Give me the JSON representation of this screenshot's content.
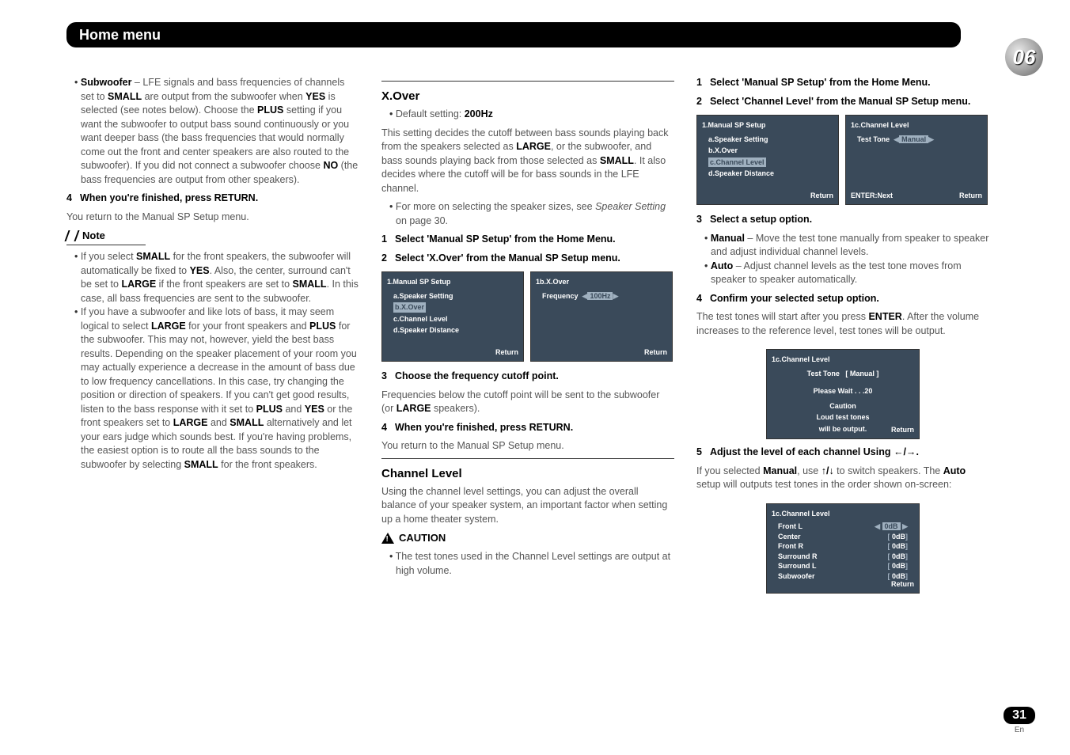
{
  "header": {
    "title": "Home menu"
  },
  "chapter": "06",
  "col1": {
    "sub_item": "Subwoofer",
    "sub_text_a": " – LFE signals and bass frequencies of channels set to ",
    "sub_small": "SMALL",
    "sub_text_b": " are output from the subwoofer when ",
    "sub_yes": "YES",
    "sub_text_c": " is selected (see notes below). Choose the ",
    "sub_plus": "PLUS",
    "sub_text_d": " setting if you want the subwoofer to output bass sound continuously or you want deeper bass (the bass frequencies that would normally come out the front and center speakers are also routed to the subwoofer). If you did not connect a subwoofer choose ",
    "sub_no": "NO",
    "sub_text_e": " (the bass frequencies are output from other speakers).",
    "step4": "When you're finished, press RETURN.",
    "step4_after": "You return to the Manual SP Setup menu.",
    "note_label": "Note",
    "note1_a": "If you select ",
    "note1_small": "SMALL",
    "note1_b": " for the front speakers, the subwoofer will automatically be fixed to ",
    "note1_yes": "YES",
    "note1_c": ". Also, the center, surround can't be set to ",
    "note1_large": "LARGE",
    "note1_d": " if the front speakers are set to ",
    "note1_small2": "SMALL",
    "note1_e": ". In this case, all bass frequencies are sent to the subwoofer.",
    "note2_a": "If you have a subwoofer and like lots of bass, it may seem logical to select ",
    "note2_large": "LARGE",
    "note2_b": " for your front speakers and ",
    "note2_plus": "PLUS",
    "note2_c": " for the subwoofer. This may not, however, yield the best bass results. Depending on the speaker placement of your room you may actually experience a decrease in the amount of bass due to low frequency cancellations. In this case, try changing the position or direction of speakers. If you can't get good results, listen to the bass response with it set to ",
    "note2_plus2": "PLUS",
    "note2_d": " and ",
    "note2_yes": "YES",
    "note2_e": " or the front speakers set to ",
    "note2_large2": "LARGE",
    "note2_f": " and ",
    "note2_small": "SMALL",
    "note2_g": " alternatively and let your ears judge which sounds best. If you're having problems, the easiest option is to route all the bass sounds to the subwoofer by selecting ",
    "note2_small2": "SMALL",
    "note2_h": " for the front speakers."
  },
  "col2": {
    "xover_title": "X.Over",
    "default_label": "Default setting: ",
    "default_val": "200Hz",
    "xover_desc_a": "This setting decides the cutoff between bass sounds playing back from the speakers selected as ",
    "xover_large": "LARGE",
    "xover_desc_b": ", or the subwoofer, and bass sounds playing back from those selected as ",
    "xover_small": "SMALL",
    "xover_desc_c": ". It also decides where the cutoff will be for bass sounds in the LFE channel.",
    "xover_more_a": "For more on selecting the speaker sizes, see ",
    "xover_more_i": "Speaker Setting",
    "xover_more_b": " on page 30.",
    "step1": "Select 'Manual SP Setup' from the Home Menu.",
    "step2": "Select 'X.Over' from the Manual SP Setup menu.",
    "osd1": {
      "title": "1.Manual SP Setup",
      "a": "a.Speaker Setting",
      "b": "b.X.Over",
      "c": "c.Channel Level",
      "d": "d.Speaker Distance",
      "return": "Return"
    },
    "osd2": {
      "title": "1b.X.Over",
      "freq_label": "Frequency",
      "freq_val": "100Hz",
      "return": "Return"
    },
    "step3": "Choose the frequency cutoff point.",
    "step3_after_a": "Frequencies below the cutoff point will be sent to the subwoofer (or ",
    "step3_large": "LARGE",
    "step3_after_b": " speakers).",
    "step4": "When you're finished, press RETURN.",
    "step4_after": "You return to the Manual SP Setup menu.",
    "ch_title": "Channel Level",
    "ch_desc": "Using the channel level settings, you can adjust the overall balance of your speaker system, an important factor when setting up a home theater system.",
    "caution_label": "CAUTION",
    "caution_text": "The test tones used in the Channel Level settings are output at high volume."
  },
  "col3": {
    "step1": "Select 'Manual SP Setup' from the Home Menu.",
    "step2": "Select 'Channel Level' from the Manual SP Setup menu.",
    "osd1": {
      "title": "1.Manual SP Setup",
      "a": "a.Speaker Setting",
      "b": "b.X.Over",
      "c": "c.Channel Level",
      "d": "d.Speaker Distance",
      "return": "Return"
    },
    "osd2": {
      "title": "1c.Channel Level",
      "tone_label": "Test Tone",
      "tone_val": "Manual",
      "enter": "ENTER:Next",
      "return": "Return"
    },
    "step3": "Select a setup option.",
    "manual_b": "Manual",
    "manual_t": " – Move the test tone manually from speaker to speaker and adjust individual channel levels.",
    "auto_b": "Auto",
    "auto_t": " – Adjust channel levels as the test tone moves from speaker to speaker automatically.",
    "step4": "Confirm your selected setup option.",
    "step4_after_a": "The test tones will start after you press ",
    "enter_b": "ENTER",
    "step4_after_b": ". After the volume increases to the reference level, test tones will be output.",
    "osd3": {
      "title": "1c.Channel Level",
      "tone_label": "Test Tone",
      "tone_val": "[ Manual ]",
      "wait": "Please Wait . . .20",
      "caution": "Caution",
      "loud1": "Loud test tones",
      "loud2": "will be output.",
      "return": "Return"
    },
    "step5_a": "Adjust the level of each channel Using ",
    "step5_arrows": "←/→",
    "step5_b": ".",
    "step5_after_a": "If you selected ",
    "manual_b2": "Manual",
    "step5_after_b": ", use ",
    "updown": "↑/↓",
    "step5_after_c": " to switch speakers. The ",
    "auto_b2": "Auto",
    "step5_after_d": " setup will outputs test tones in the order shown on-screen:",
    "osd4": {
      "title": "1c.Channel Level",
      "rows": [
        {
          "name": "Front L",
          "val": "0dB"
        },
        {
          "name": "Center",
          "val": "0dB"
        },
        {
          "name": "Front R",
          "val": "0dB"
        },
        {
          "name": "Surround R",
          "val": "0dB"
        },
        {
          "name": "Surround L",
          "val": "0dB"
        },
        {
          "name": "Subwoofer",
          "val": "0dB"
        }
      ],
      "return": "Return"
    }
  },
  "page_number": "31",
  "lang": "En"
}
